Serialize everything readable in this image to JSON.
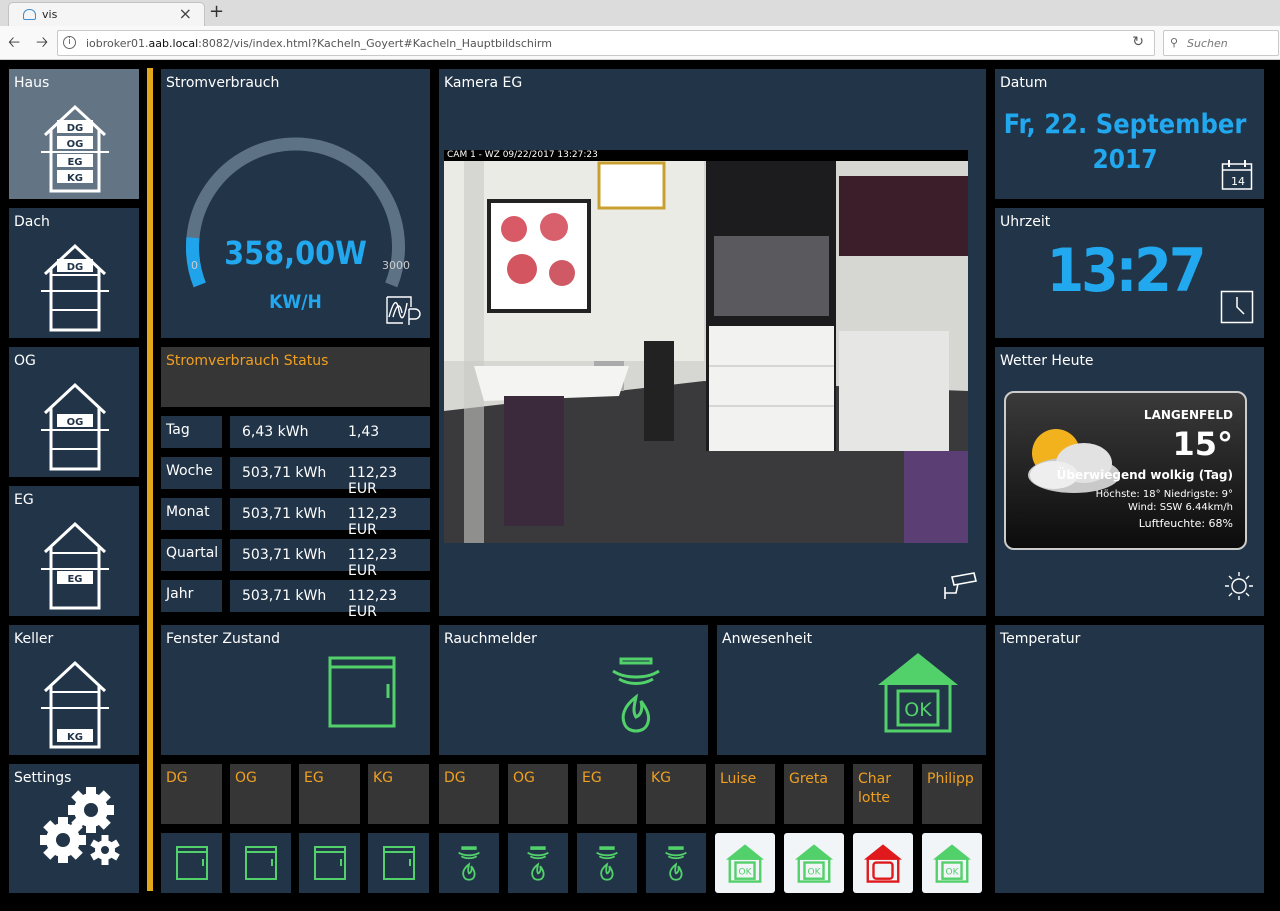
{
  "browser": {
    "tab_title": "vis",
    "url_pre": "iobroker01.",
    "url_host": "aab.local",
    "url_post": ":8082/vis/index.html?Kacheln_Goyert#Kacheln_Hauptbildschirm",
    "search_placeholder": "Suchen"
  },
  "nav": {
    "items": [
      {
        "label": "Haus"
      },
      {
        "label": "Dach"
      },
      {
        "label": "OG"
      },
      {
        "label": "EG"
      },
      {
        "label": "Keller"
      },
      {
        "label": "Settings"
      }
    ],
    "floor_labels": [
      "DG",
      "OG",
      "EG",
      "KG"
    ]
  },
  "power": {
    "title": "Stromverbrauch",
    "value": "358,00W",
    "min": "0",
    "max": "3000",
    "unit": "KW/H",
    "gauge_fraction": 0.12
  },
  "power_status": {
    "title": "Stromverbrauch Status",
    "rows": [
      {
        "label": "Tag",
        "kwh": "6,43 kWh",
        "eur": "1,43"
      },
      {
        "label": "Woche",
        "kwh": "503,71 kWh",
        "eur": "112,23 EUR"
      },
      {
        "label": "Monat",
        "kwh": "503,71 kWh",
        "eur": "112,23 EUR"
      },
      {
        "label": "Quartal",
        "kwh": "503,71 kWh",
        "eur": "112,23 EUR"
      },
      {
        "label": "Jahr",
        "kwh": "503,71 kWh",
        "eur": "112,23 EUR"
      }
    ]
  },
  "camera": {
    "title": "Kamera EG",
    "overlay": "CAM 1 - WZ 09/22/2017 13:27:23"
  },
  "date": {
    "title": "Datum",
    "line1": "Fr, 22. September",
    "line2": "2017",
    "cal_day": "14"
  },
  "time": {
    "title": "Uhrzeit",
    "value": "13:27"
  },
  "weather": {
    "title": "Wetter Heute",
    "city": "LANGENFELD",
    "temp": "15°",
    "desc": "Überwiegend wolkig (Tag)",
    "hilo": "Höchste: 18° Niedrigste: 9°",
    "wind": "Wind: SSW 6.44km/h",
    "humidity": "Luftfeuchte: 68%"
  },
  "windows": {
    "title": "Fenster Zustand"
  },
  "smoke": {
    "title": "Rauchmelder"
  },
  "presence": {
    "title": "Anwesenheit",
    "ok": "OK"
  },
  "temperature": {
    "title": "Temperatur"
  },
  "sub_windows": [
    "DG",
    "OG",
    "EG",
    "KG"
  ],
  "sub_smoke": [
    "DG",
    "OG",
    "EG",
    "KG"
  ],
  "persons": [
    {
      "name": "Luise",
      "status": "ok"
    },
    {
      "name": "Greta",
      "status": "ok"
    },
    {
      "name": "Char\nlotte",
      "status": "away"
    },
    {
      "name": "Philipp",
      "status": "ok"
    }
  ],
  "colors": {
    "tile": "#223448",
    "accent": "#21a8ee",
    "orange": "#f0a020",
    "green": "#52d06a",
    "red": "#e0191d"
  }
}
